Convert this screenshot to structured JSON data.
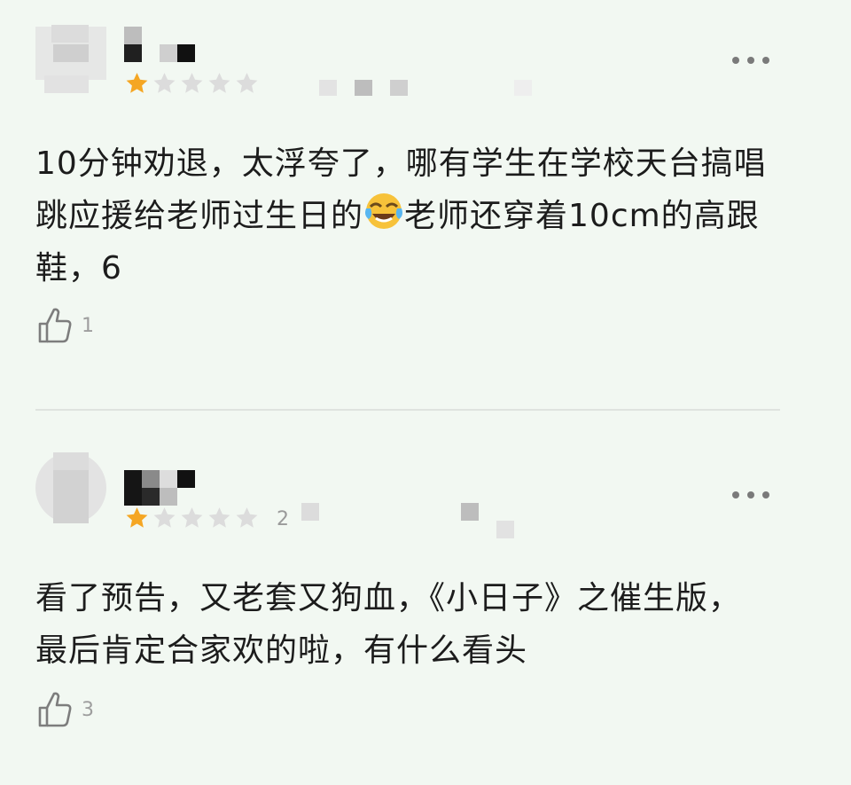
{
  "reviews": [
    {
      "rating": 1,
      "max_rating": 5,
      "text_parts": [
        "10分钟劝退，太浮夸了，哪有学生在学校天台搞唱跳应援给老师过生日的",
        "老师还穿着10cm的高跟鞋，6"
      ],
      "emoji": "face-with-tears-of-joy",
      "rating_suffix": "",
      "like_count": "1"
    },
    {
      "rating": 1,
      "max_rating": 5,
      "text": "看了预告，又老套又狗血，《小日子》之催生版，最后肯定合家欢的啦，有什么看头",
      "rating_suffix": "2",
      "like_count": "3"
    }
  ],
  "colors": {
    "background": "#f2f8f2",
    "star_filled": "#f5a623",
    "star_empty": "#dcdcdc",
    "text": "#1c1c1c",
    "muted": "#9e9e9e"
  },
  "icons": {
    "like": "thumbs-up-icon",
    "more": "more-dots-icon",
    "star": "star-icon"
  }
}
